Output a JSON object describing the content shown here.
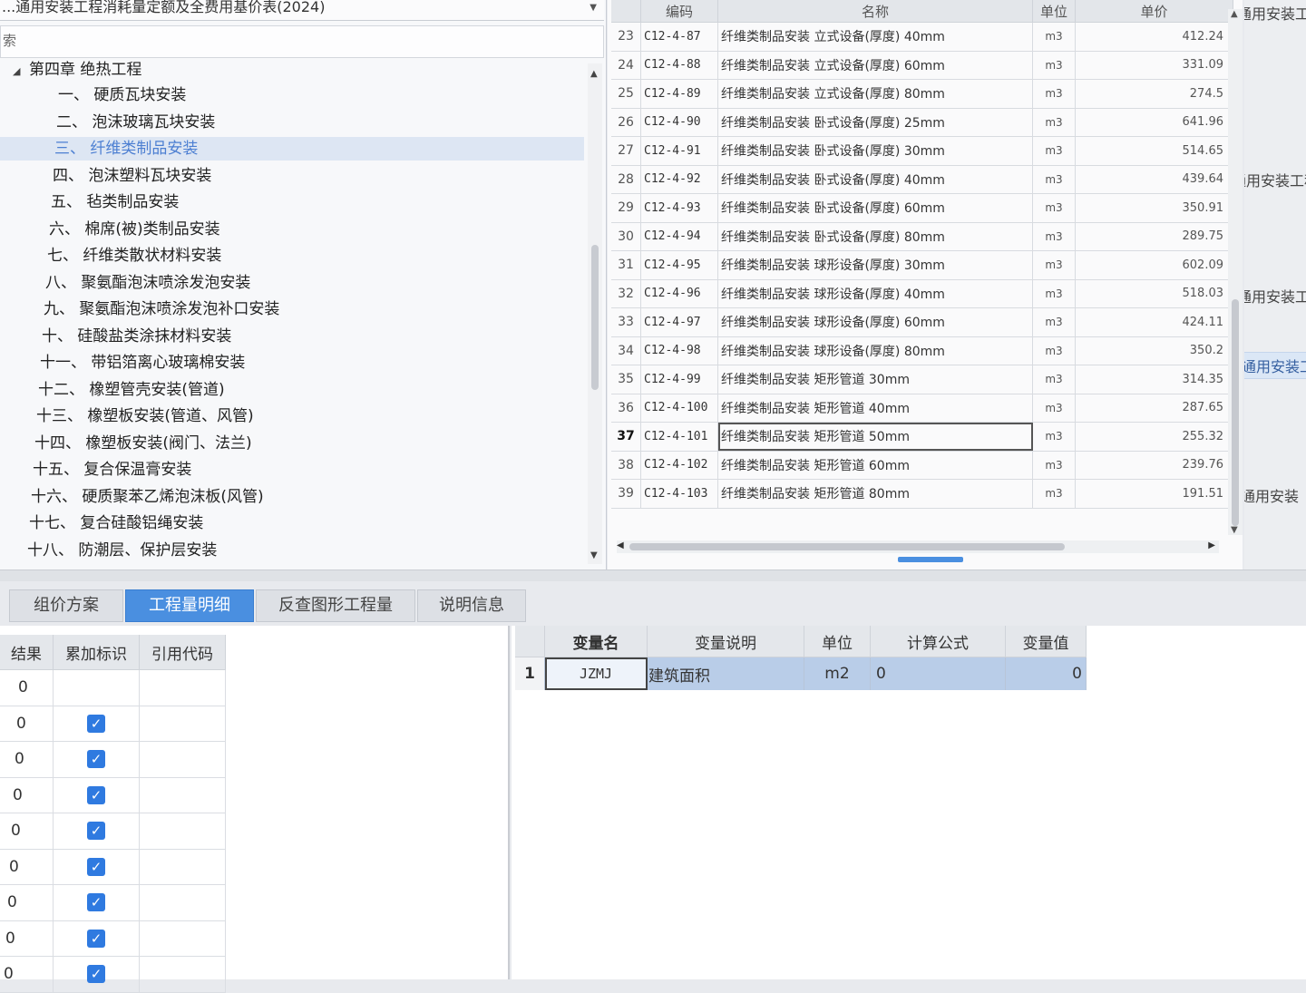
{
  "library": {
    "title": "...通用安装工程消耗量定额及全费用基价表(2024)",
    "search_placeholder": "索"
  },
  "tree": {
    "chapter": "第四章 绝热工程",
    "items": [
      {
        "label": "一、 硬质瓦块安装"
      },
      {
        "label": "二、 泡沫玻璃瓦块安装"
      },
      {
        "label": "三、 纤维类制品安装",
        "selected": true
      },
      {
        "label": "四、 泡沫塑料瓦块安装"
      },
      {
        "label": "五、 毡类制品安装"
      },
      {
        "label": "六、 棉席(被)类制品安装"
      },
      {
        "label": "七、 纤维类散状材料安装"
      },
      {
        "label": "八、 聚氨酯泡沫喷涂发泡安装"
      },
      {
        "label": "九、 聚氨酯泡沫喷涂发泡补口安装"
      },
      {
        "label": "十、 硅酸盐类涂抹材料安装"
      },
      {
        "label": "十一、 带铝箔离心玻璃棉安装"
      },
      {
        "label": "十二、 橡塑管壳安装(管道)"
      },
      {
        "label": "十三、 橡塑板安装(管道、风管)"
      },
      {
        "label": "十四、 橡塑板安装(阀门、法兰)"
      },
      {
        "label": "十五、 复合保温膏安装"
      },
      {
        "label": "十六、 硬质聚苯乙烯泡沫板(风管)"
      },
      {
        "label": "十七、 复合硅酸铝绳安装"
      },
      {
        "label": "十八、 防潮层、保护层安装"
      }
    ]
  },
  "quota_table": {
    "headers": {
      "num": "",
      "code": "编码",
      "name": "名称",
      "unit": "单位",
      "price": "单价"
    },
    "rows": [
      {
        "num": "23",
        "code": "C12-4-87",
        "name": "纤维类制品安装 立式设备(厚度) 40mm",
        "unit": "m3",
        "price": "412.24"
      },
      {
        "num": "24",
        "code": "C12-4-88",
        "name": "纤维类制品安装 立式设备(厚度) 60mm",
        "unit": "m3",
        "price": "331.09"
      },
      {
        "num": "25",
        "code": "C12-4-89",
        "name": "纤维类制品安装 立式设备(厚度) 80mm",
        "unit": "m3",
        "price": "274.5"
      },
      {
        "num": "26",
        "code": "C12-4-90",
        "name": "纤维类制品安装 卧式设备(厚度) 25mm",
        "unit": "m3",
        "price": "641.96"
      },
      {
        "num": "27",
        "code": "C12-4-91",
        "name": "纤维类制品安装 卧式设备(厚度) 30mm",
        "unit": "m3",
        "price": "514.65"
      },
      {
        "num": "28",
        "code": "C12-4-92",
        "name": "纤维类制品安装 卧式设备(厚度) 40mm",
        "unit": "m3",
        "price": "439.64"
      },
      {
        "num": "29",
        "code": "C12-4-93",
        "name": "纤维类制品安装 卧式设备(厚度) 60mm",
        "unit": "m3",
        "price": "350.91"
      },
      {
        "num": "30",
        "code": "C12-4-94",
        "name": "纤维类制品安装 卧式设备(厚度) 80mm",
        "unit": "m3",
        "price": "289.75"
      },
      {
        "num": "31",
        "code": "C12-4-95",
        "name": "纤维类制品安装 球形设备(厚度) 30mm",
        "unit": "m3",
        "price": "602.09"
      },
      {
        "num": "32",
        "code": "C12-4-96",
        "name": "纤维类制品安装 球形设备(厚度) 40mm",
        "unit": "m3",
        "price": "518.03"
      },
      {
        "num": "33",
        "code": "C12-4-97",
        "name": "纤维类制品安装 球形设备(厚度) 60mm",
        "unit": "m3",
        "price": "424.11"
      },
      {
        "num": "34",
        "code": "C12-4-98",
        "name": "纤维类制品安装 球形设备(厚度) 80mm",
        "unit": "m3",
        "price": "350.2"
      },
      {
        "num": "35",
        "code": "C12-4-99",
        "name": "纤维类制品安装 矩形管道 30mm",
        "unit": "m3",
        "price": "314.35"
      },
      {
        "num": "36",
        "code": "C12-4-100",
        "name": "纤维类制品安装 矩形管道 40mm",
        "unit": "m3",
        "price": "287.65"
      },
      {
        "num": "37",
        "code": "C12-4-101",
        "name": "纤维类制品安装 矩形管道 50mm",
        "unit": "m3",
        "price": "255.32",
        "current": true
      },
      {
        "num": "38",
        "code": "C12-4-102",
        "name": "纤维类制品安装 矩形管道 60mm",
        "unit": "m3",
        "price": "239.76"
      },
      {
        "num": "39",
        "code": "C12-4-103",
        "name": "纤维类制品安装 矩形管道 80mm",
        "unit": "m3",
        "price": "191.51"
      }
    ]
  },
  "right_column": [
    "通用安装工程",
    "通用安装工程",
    "通用安装工",
    "通用安装工",
    "通用安装"
  ],
  "tabs": [
    {
      "label": "组价方案"
    },
    {
      "label": "工程量明细",
      "active": true
    },
    {
      "label": "反查图形工程量"
    },
    {
      "label": "说明信息"
    }
  ],
  "detail_table": {
    "headers": [
      "结果",
      "累加标识",
      "引用代码"
    ],
    "rows": [
      {
        "result": "0",
        "checked": false
      },
      {
        "result": "0",
        "checked": true
      },
      {
        "result": "0",
        "checked": true
      },
      {
        "result": "0",
        "checked": true
      },
      {
        "result": "0",
        "checked": true
      },
      {
        "result": "0",
        "checked": true
      },
      {
        "result": "0",
        "checked": true
      },
      {
        "result": "0",
        "checked": true
      },
      {
        "result": "0",
        "checked": true
      }
    ]
  },
  "variable_table": {
    "headers": [
      "变量名",
      "变量说明",
      "单位",
      "计算公式",
      "变量值"
    ],
    "rows": [
      {
        "num": "1",
        "name": "JZMJ",
        "desc": "建筑面积",
        "unit": "m2",
        "formula": "0",
        "value": "0"
      }
    ]
  }
}
